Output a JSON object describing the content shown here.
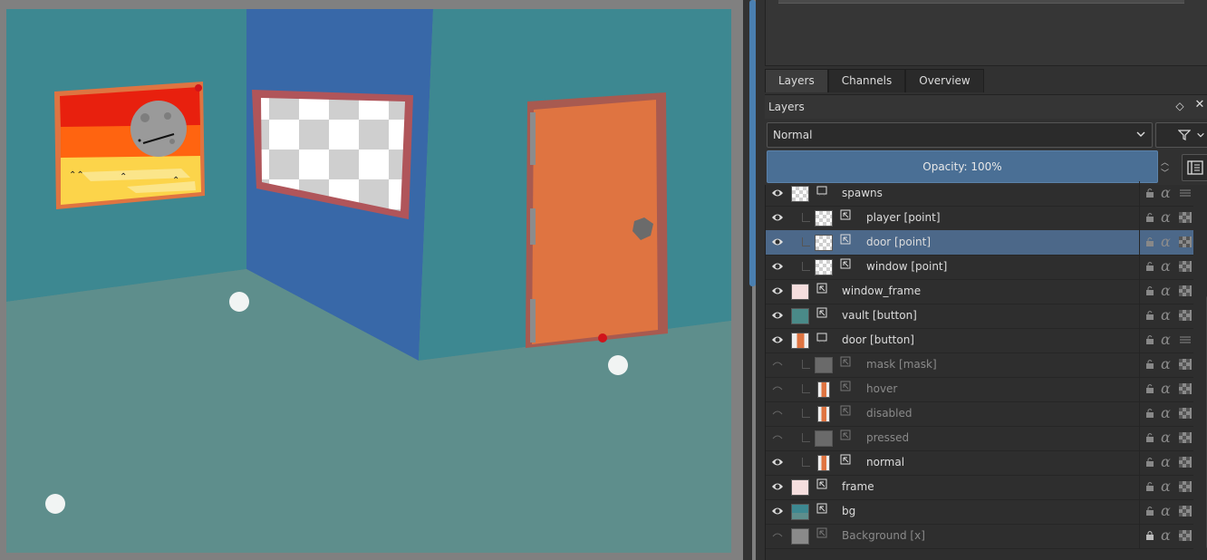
{
  "tabs": [
    {
      "label": "Layers",
      "active": true
    },
    {
      "label": "Channels",
      "active": false
    },
    {
      "label": "Overview",
      "active": false
    }
  ],
  "layers_panel": {
    "title": "Layers",
    "blend_mode": "Normal",
    "opacity_label": "Opacity:  100%",
    "opacity": 1.0
  },
  "layers": [
    {
      "name": "spawns",
      "indent": 0,
      "visible": true,
      "type": "group",
      "thumb": "checker"
    },
    {
      "name": "player [point]",
      "indent": 1,
      "visible": true,
      "type": "paint",
      "thumb": "checker"
    },
    {
      "name": "door [point]",
      "indent": 1,
      "visible": true,
      "type": "paint",
      "thumb": "checker",
      "selected": true
    },
    {
      "name": "window [point]",
      "indent": 1,
      "visible": true,
      "type": "paint",
      "thumb": "checker"
    },
    {
      "name": "window_frame",
      "indent": 0,
      "visible": true,
      "type": "paint",
      "thumb": "frame-red"
    },
    {
      "name": "vault [button]",
      "indent": 0,
      "visible": true,
      "type": "paint",
      "thumb": "vault"
    },
    {
      "name": "door [button]",
      "indent": 0,
      "visible": true,
      "type": "group",
      "thumb": "door"
    },
    {
      "name": "mask [mask]",
      "indent": 1,
      "visible": false,
      "type": "paint",
      "thumb": "dark"
    },
    {
      "name": "hover",
      "indent": 1,
      "visible": false,
      "type": "paint",
      "thumb": "door"
    },
    {
      "name": "disabled",
      "indent": 1,
      "visible": false,
      "type": "paint",
      "thumb": "door"
    },
    {
      "name": "pressed",
      "indent": 1,
      "visible": false,
      "type": "paint",
      "thumb": "dark"
    },
    {
      "name": "normal",
      "indent": 1,
      "visible": true,
      "type": "paint",
      "thumb": "door"
    },
    {
      "name": "frame",
      "indent": 0,
      "visible": true,
      "type": "paint",
      "thumb": "frame-red"
    },
    {
      "name": "bg",
      "indent": 0,
      "visible": true,
      "type": "paint",
      "thumb": "bg"
    },
    {
      "name": "Background [x]",
      "indent": 0,
      "visible": false,
      "type": "paint",
      "thumb": "gray",
      "locked": true
    }
  ],
  "colors": {
    "wall_left": "#3d8891",
    "wall_middle": "#3868a8",
    "floor": "#5e8e8c",
    "door": "#df7441",
    "door_frame": "#a85a50",
    "selection": "#4c6889",
    "opacity_bar": "#4a6f95"
  },
  "icons": {
    "visibility": "eye-icon",
    "lock": "lock-icon",
    "alpha": "alpha-icon",
    "inherit_alpha": "checker-icon",
    "filter": "filter-icon",
    "layer_properties": "properties-icon",
    "float": "float-icon",
    "close": "close-icon"
  }
}
